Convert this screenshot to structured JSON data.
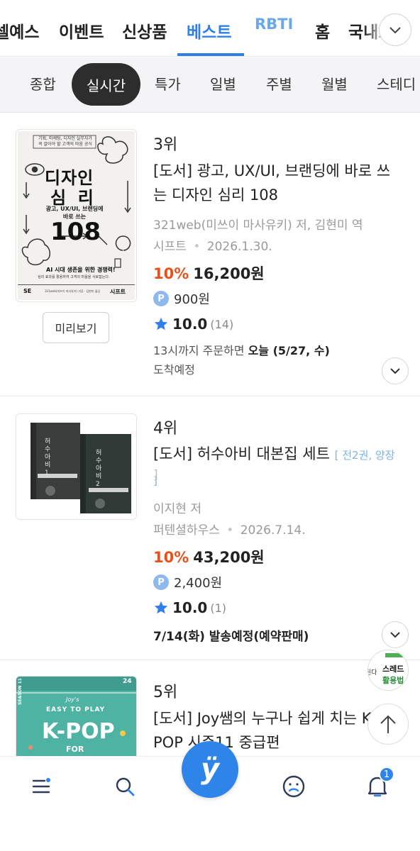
{
  "top_tabs": [
    "셀예스",
    "이벤트",
    "신상품",
    "베스트",
    "RBTI",
    "홈",
    "국내도서"
  ],
  "sub_tabs": [
    "종합",
    "실시간",
    "특가",
    "일별",
    "주별",
    "월별",
    "스테디"
  ],
  "books": [
    {
      "rank": "3위",
      "title": "[도서] 광고, UX/UI, 브랜딩에 바로 쓰는 디자인 심리 108",
      "tag": "",
      "author": "321web(미쓰이 마사유키) 저, 김현미 역",
      "publisher": "시프트",
      "date": "2026.1.30.",
      "discount": "10%",
      "price": "16,200원",
      "points": "900원",
      "rating": "10.0",
      "rating_count": "(14)",
      "delivery_prefix": "13시까지 주문하면 ",
      "delivery_bold": "오늘 (5/27, 수)",
      "delivery_suffix": "도착예정",
      "preview_label": "미리보기",
      "cover": {
        "top_lines": [
          "기획, 마케팅, 디자인 실무자가",
          "꼭 알아야 할 고객의 마음 공식"
        ],
        "title1": "디자인",
        "title2": "심  리",
        "subtitle1": "광고, UX/UI, 브랜딩에",
        "subtitle2": "바로 쓰는",
        "number": "108",
        "tagline1": "AI 시대 생존을 위한 경쟁력!",
        "tagline2": "심리 효과를 활용하여 고객의 마음을 사로잡는다.",
        "logo": "SE",
        "footer": "321web(미쓰이 마사유키) 지음 · 김현미 옮김",
        "publisher": "시프트"
      }
    },
    {
      "rank": "4위",
      "title": "[도서] 허수아비 대본집 세트",
      "tag": "[ 전2권, 양장 ]",
      "author": "이지현 저",
      "publisher": "퍼텐셜하우스",
      "date": "2026.7.14.",
      "discount": "10%",
      "price": "43,200원",
      "points": "2,400원",
      "rating": "10.0",
      "rating_count": "(1)",
      "shipping": "7/14(화) 발송예정(예약판매)",
      "cover": {
        "book1": "허수아비 1",
        "book2": "허수아비 2"
      }
    },
    {
      "rank": "5위",
      "title": "[도서] Joy쌤의 누구나 쉽게 치는 K-POP 시즌11 중급편",
      "cover": {
        "season": "SEASON 11",
        "line1": "Joy's",
        "line2": "EASY TO PLAY",
        "kpop": "K-POP",
        "for": "FOR",
        "num": "24"
      }
    }
  ],
  "float_ad": {
    "line1": "스레드",
    "line2": "활용법",
    "side": "된다"
  },
  "bottom_nav": {
    "notification_count": "1",
    "home_letter": "ÿ"
  },
  "colors": {
    "accent": "#2f7fe8",
    "discount": "#e8521c",
    "star": "#2f7fe8"
  },
  "icons": [
    "chevron-down-icon",
    "star-icon",
    "point-icon",
    "menu-icon",
    "search-icon",
    "home-icon",
    "my-page-icon",
    "bell-icon",
    "arrow-up-icon"
  ]
}
